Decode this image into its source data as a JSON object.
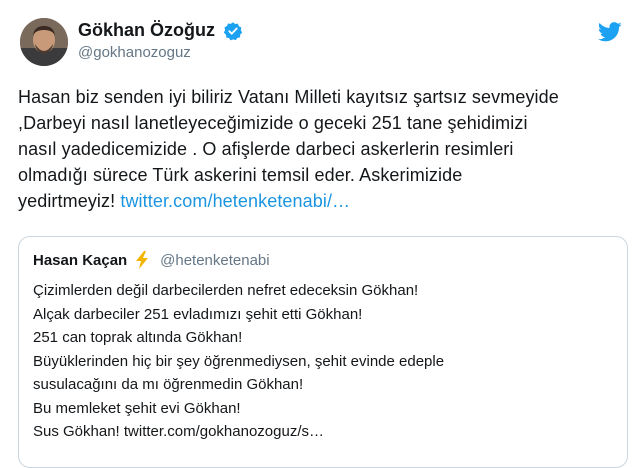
{
  "tweet": {
    "author": {
      "name": "Gökhan Özoğuz",
      "handle": "@gokhanozoguz",
      "avatar_icon": "profile-photo",
      "verified_icon": "verified-badge-icon",
      "verified_color": "#1da1f2"
    },
    "platform_icon": "twitter-bird-icon",
    "platform_color": "#1da1f2",
    "text_lines": [
      "Hasan biz senden iyi biliriz Vatanı Milleti kayıtsız şartsız sevmeyide",
      ",Darbeyi nasıl lanetleyeceğimizide o geceki 251 tane şehidimizi",
      "nasıl yadedicemizide . O afişlerde darbeci askerlerin resimleri",
      "olmadığı sürece Türk askerini temsil eder. Askerimizide"
    ],
    "last_line_text": "yedirtmeyiz!",
    "link_text": "twitter.com/hetenketenabi/…",
    "link_color": "#1b95e0"
  },
  "quoted_tweet": {
    "author_name": "Hasan Kaçan",
    "name_emoji_icon": "lightning-bolt-icon",
    "author_handle": "@hetenketenabi",
    "text_lines": [
      "Çizimlerden değil darbecilerden nefret edeceksin Gökhan!",
      "Alçak darbeciler 251 evladımızı şehit etti Gökhan!",
      "251 can toprak altında Gökhan!",
      "Büyüklerinden hiç bir şey öğrenmediysen, şehit evinde edeple",
      "susulacağını da mı öğrenmedin Gökhan!",
      "Bu memleket şehit evi Gökhan!",
      "Sus Gökhan! twitter.com/gokhanozoguz/s…"
    ]
  }
}
